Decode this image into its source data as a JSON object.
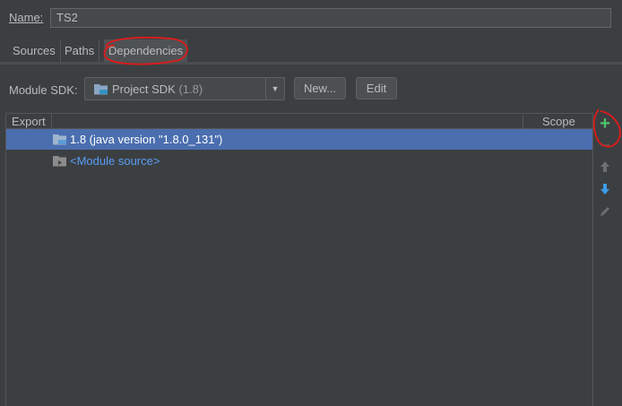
{
  "name_row": {
    "label": "Name:",
    "value": "TS2"
  },
  "tabs": [
    {
      "label": "Sources"
    },
    {
      "label": "Paths"
    },
    {
      "label": "Dependencies"
    }
  ],
  "sdk_row": {
    "label": "Module SDK:",
    "selected": "Project SDK",
    "selected_version": "(1.8)",
    "new_button": "New...",
    "edit_button": "Edit"
  },
  "table": {
    "columns": {
      "export": "Export",
      "scope": "Scope"
    },
    "rows": [
      {
        "label": "1.8 (java version \"1.8.0_131\")",
        "icon": "jdk-folder-icon",
        "selected": true
      },
      {
        "label": "<Module source>",
        "icon": "module-source-folder-icon",
        "selected": false
      }
    ]
  },
  "toolbar": {
    "add_icon": "plus-icon",
    "remove_icon": "minus-icon",
    "up_icon": "arrow-up-icon",
    "down_icon": "arrow-down-icon",
    "edit_icon": "pencil-icon"
  },
  "colors": {
    "background": "#3c3f41",
    "selection": "#4b6eaf",
    "link": "#589df6",
    "add_green": "#4ec66a",
    "annotation_red": "#e11a1a"
  }
}
